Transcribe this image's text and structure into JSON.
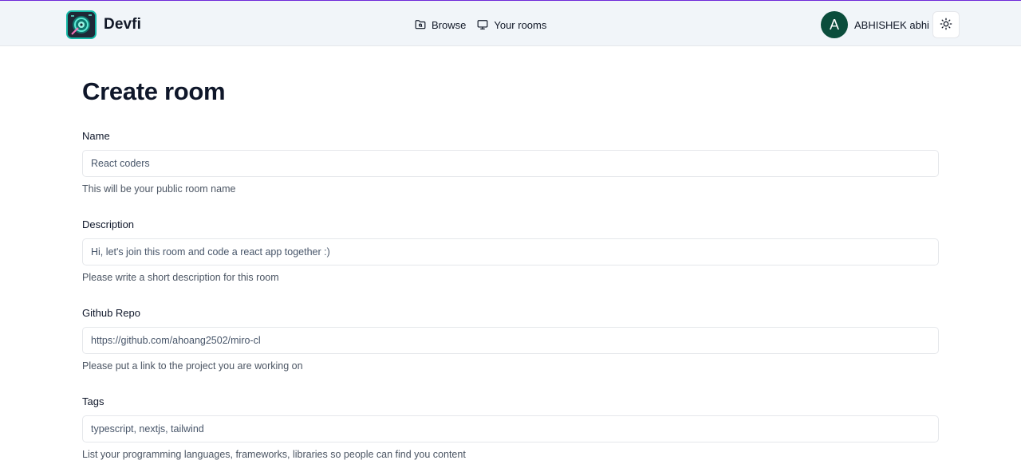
{
  "header": {
    "brand_name": "Devfi",
    "nav": {
      "browse_label": "Browse",
      "your_rooms_label": "Your rooms"
    },
    "user": {
      "avatar_initial": "A",
      "name": "ABHISHEK abhi"
    },
    "theme_toggle_icon": "sun-icon"
  },
  "main": {
    "title": "Create room",
    "fields": [
      {
        "label": "Name",
        "value": "React coders",
        "help": "This will be your public room name"
      },
      {
        "label": "Description",
        "value": "Hi, let's join this room and code a react app together :)",
        "help": "Please write a short description for this room"
      },
      {
        "label": "Github Repo",
        "value": "https://github.com/ahoang2502/miro-cl",
        "help": "Please put a link to the project you are working on"
      },
      {
        "label": "Tags",
        "value": "typescript, nextjs, tailwind",
        "help": "List your programming languages, frameworks, libraries so people can find you content"
      }
    ]
  },
  "colors": {
    "accent_line": "#6d28d9",
    "header_bg": "#f1f5f9",
    "avatar_bg": "#0b4d3c",
    "logo_ring": "#14b8a6"
  }
}
